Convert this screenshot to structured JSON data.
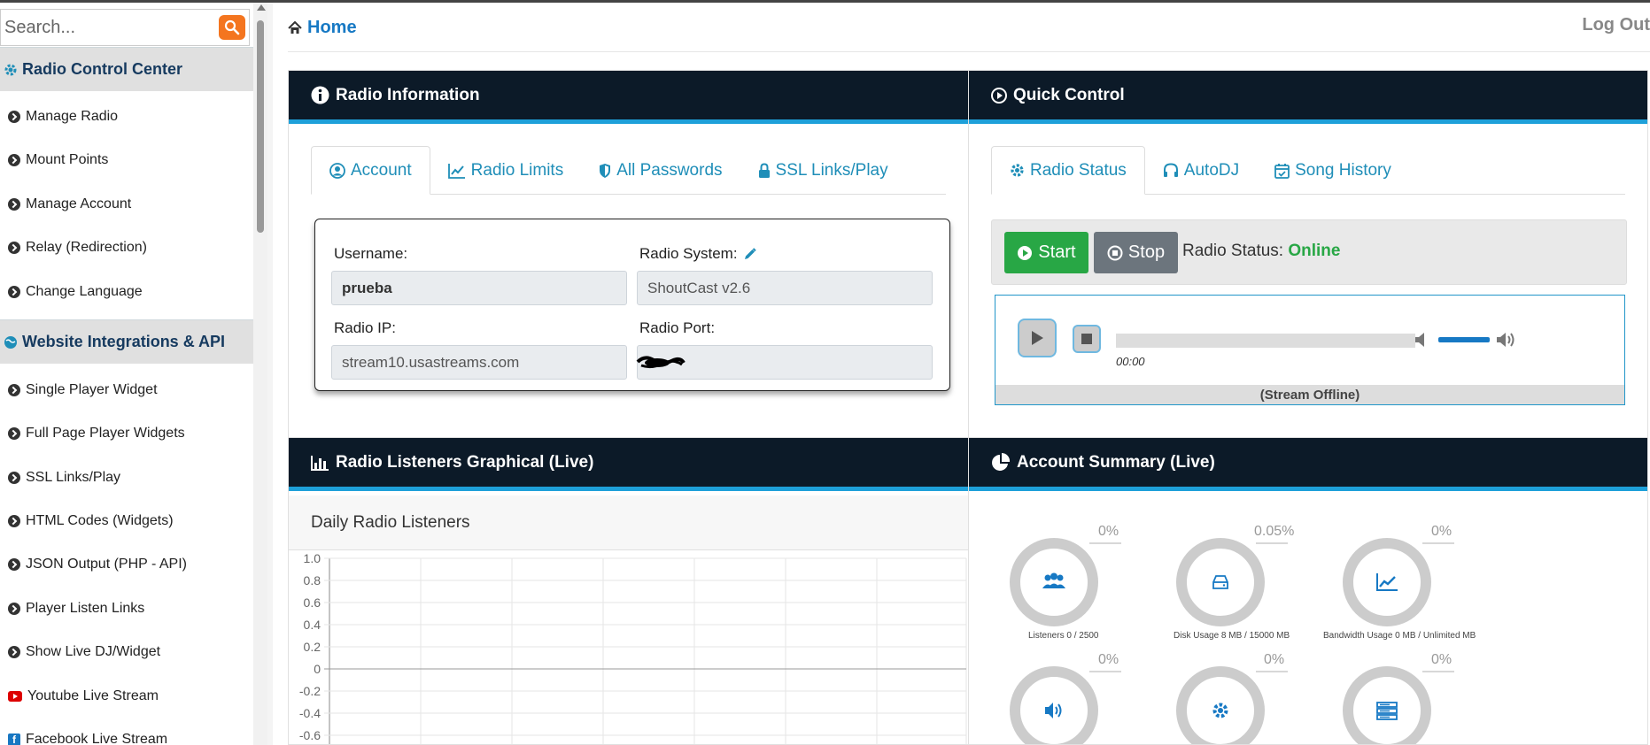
{
  "sidebar": {
    "search_placeholder": "Search...",
    "sections": [
      {
        "title": "Radio Control Center"
      },
      {
        "title": "Website Integrations & API"
      }
    ],
    "radio_items": [
      "Manage Radio",
      "Mount Points",
      "Manage Account",
      "Relay (Redirection)",
      "Change Language"
    ],
    "integration_items": [
      "Single Player Widget",
      "Full Page Player Widgets",
      "SSL Links/Play",
      "HTML Codes (Widgets)",
      "JSON Output (PHP - API)",
      "Player Listen Links",
      "Show Live DJ/Widget",
      "Youtube Live Stream",
      "Facebook Live Stream"
    ]
  },
  "header": {
    "home": "Home",
    "logout": "Log Out"
  },
  "radio_info": {
    "title": "Radio Information",
    "tabs": [
      "Account",
      "Radio Limits",
      "All Passwords",
      "SSL Links/Play"
    ],
    "username_label": "Username:",
    "username_value": "prueba",
    "system_label": "Radio System:",
    "system_value": "ShoutCast v2.6",
    "ip_label": "Radio IP:",
    "ip_value": "stream10.usastreams.com",
    "port_label": "Radio Port:"
  },
  "quick_control": {
    "title": "Quick Control",
    "tabs": [
      "Radio Status",
      "AutoDJ",
      "Song History"
    ],
    "start_label": "Start",
    "stop_label": "Stop",
    "status_label": "Radio Status:",
    "status_value": "Online",
    "player_time": "00:00",
    "player_status": "(Stream Offline)"
  },
  "listeners": {
    "title": "Radio Listeners Graphical (Live)",
    "subtitle": "Daily Radio Listeners"
  },
  "summary": {
    "title": "Account Summary (Live)",
    "gauges": [
      {
        "pct": "0%",
        "caption": "Listeners 0 / 2500",
        "icon": "users-icon"
      },
      {
        "pct": "0.05%",
        "caption": "Disk Usage 8 MB / 15000 MB",
        "icon": "hdd-icon"
      },
      {
        "pct": "0%",
        "caption": "Bandwidth Usage 0 MB / Unlimited MB",
        "icon": "line-chart-icon"
      },
      {
        "pct": "0%",
        "caption": "",
        "icon": "volume-icon"
      },
      {
        "pct": "0%",
        "caption": "",
        "icon": "gear-icon"
      },
      {
        "pct": "0%",
        "caption": "",
        "icon": "server-icon"
      }
    ]
  },
  "chart_data": {
    "type": "line",
    "title": "Daily Radio Listeners",
    "y_ticks": [
      "1.0",
      "0.8",
      "0.6",
      "0.4",
      "0.2",
      "0",
      "-0.2",
      "-0.4",
      "-0.6"
    ],
    "ylim": [
      -0.6,
      1.0
    ],
    "grid": true,
    "series": []
  },
  "colors": {
    "accent": "#1ea0d9",
    "panel_head": "#0c1a28",
    "online": "#28a745",
    "link": "#1779c4",
    "search_btn": "#f4751f"
  }
}
